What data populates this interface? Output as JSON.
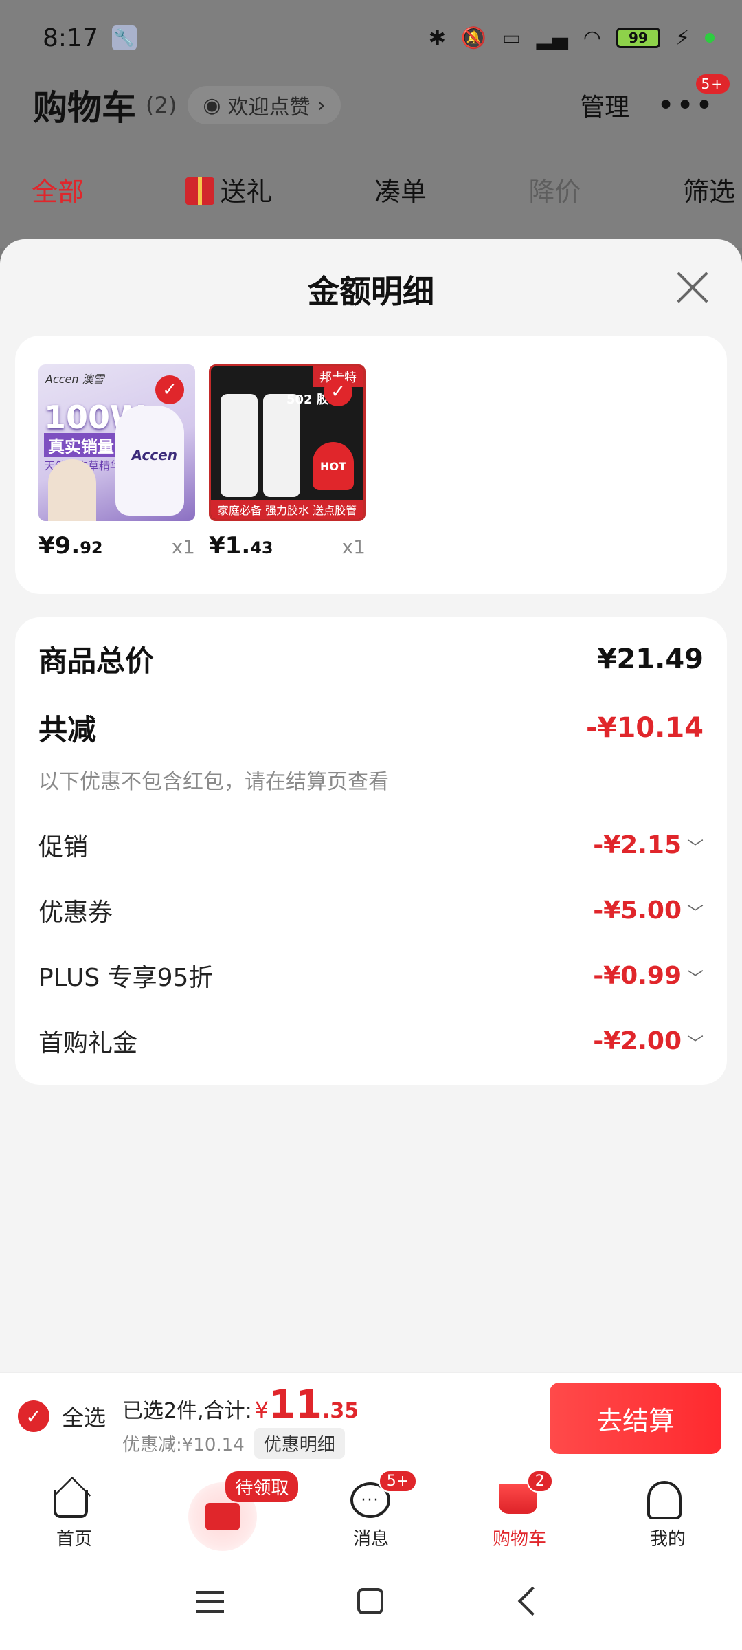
{
  "status_bar": {
    "time": "8:17",
    "battery": "99"
  },
  "header": {
    "title": "购物车",
    "count": "(2)",
    "pill": "欢迎点赞",
    "manage": "管理",
    "more_badge": "5+"
  },
  "tabs": [
    {
      "label": "全部"
    },
    {
      "label": "送礼"
    },
    {
      "label": "凑单"
    },
    {
      "label": "降价"
    },
    {
      "label": "筛选"
    }
  ],
  "sheet": {
    "title": "金额明细",
    "products": [
      {
        "brand": "Accen 澳雪",
        "headline": "100W",
        "tag": "真实销量",
        "sub": "天然薰衣草精华",
        "bottle_text": "Accen",
        "price_int": "¥9.",
        "price_dec": "92",
        "qty": "x1"
      },
      {
        "tag": "邦卡特",
        "title": "502 胶",
        "hot": "HOT",
        "banner": "家庭必备 强力胶水 送点胶管",
        "price_int": "¥1.",
        "price_dec": "43",
        "qty": "x1"
      }
    ],
    "summary": {
      "total_label": "商品总价",
      "total_value": "¥21.49",
      "discount_label": "共减",
      "discount_value": "-¥10.14",
      "note": "以下优惠不包含红包，请在结算页查看",
      "items": [
        {
          "label": "促销",
          "value": "-¥2.15"
        },
        {
          "label": "优惠券",
          "value": "-¥5.00"
        },
        {
          "label": "PLUS 专享95折",
          "value": "-¥0.99"
        },
        {
          "label": "首购礼金",
          "value": "-¥2.00"
        }
      ]
    }
  },
  "checkout": {
    "select_all": "全选",
    "selected_text": "已选2件,合计:",
    "yen": "¥",
    "total_int": "11",
    "total_dec": ".35",
    "saved": "优惠减:¥10.14",
    "detail_btn": "优惠明细",
    "pay": "去结算"
  },
  "tabbar": {
    "home": "首页",
    "coupon_tag": "待领取",
    "messages": "消息",
    "messages_badge": "5+",
    "cart": "购物车",
    "cart_badge": "2",
    "me": "我的"
  }
}
